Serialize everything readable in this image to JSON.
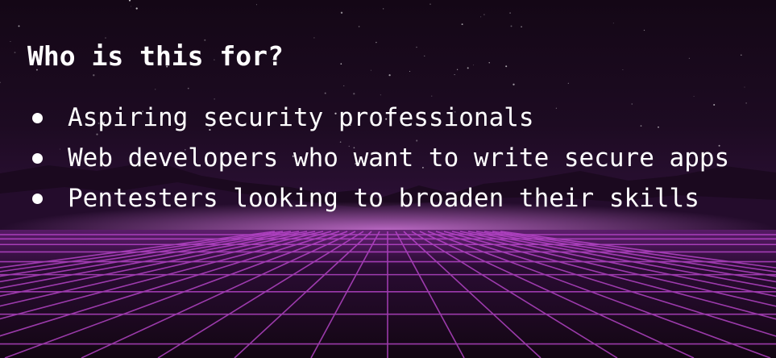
{
  "slide": {
    "title": "Who is this for?",
    "bullets": [
      {
        "text": "Aspiring security professionals"
      },
      {
        "text": "Web developers who want to write secure apps"
      },
      {
        "text": "Pentesters looking to broaden their skills"
      }
    ]
  },
  "colors": {
    "text": "#ffffff",
    "grid_line": "#c64bd9",
    "horizon_glow": "#e884f2",
    "sky_top": "#140716"
  }
}
